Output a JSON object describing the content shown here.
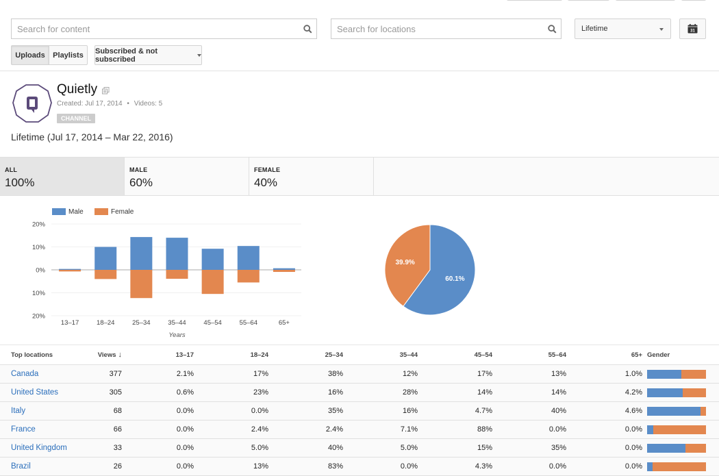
{
  "colors": {
    "male": "#5a8dc8",
    "female": "#e3874f",
    "link": "#2a6ebb",
    "logo": "#5b4a7a"
  },
  "toolbar": {
    "content_search_placeholder": "Search for content",
    "locations_search_placeholder": "Search for locations",
    "period_select": "Lifetime",
    "calendar_day": "31",
    "uploads_label": "Uploads",
    "playlists_label": "Playlists",
    "subscription_filter": "Subscribed & not subscribed"
  },
  "channel": {
    "name": "Quietly",
    "created": "Created: Jul 17, 2014",
    "separator": "•",
    "videos": "Videos: 5",
    "badge": "CHANNEL",
    "logo_letter": "Q"
  },
  "range_label": "Lifetime (Jul 17, 2014 – Mar 22, 2016)",
  "segments": [
    {
      "label": "ALL",
      "value": "100%"
    },
    {
      "label": "MALE",
      "value": "60%"
    },
    {
      "label": "FEMALE",
      "value": "40%"
    }
  ],
  "chart_data": [
    {
      "type": "bar",
      "title": "",
      "xlabel": "Years",
      "ylabel": "",
      "categories": [
        "13–17",
        "18–24",
        "25–34",
        "35–44",
        "45–54",
        "55–64",
        "65+"
      ],
      "series": [
        {
          "name": "Male",
          "values": [
            0.4,
            10.0,
            14.3,
            14.0,
            9.2,
            10.4,
            0.7
          ]
        },
        {
          "name": "Female",
          "values": [
            0.7,
            4.0,
            12.3,
            3.9,
            10.5,
            5.5,
            0.9
          ]
        }
      ],
      "yticks": [
        "20%",
        "10%",
        "0%",
        "10%",
        "20%"
      ],
      "ylim": [
        -20,
        20
      ],
      "grid": true,
      "legend": "top-left",
      "note": "Male bars drawn above zero line, Female bars drawn below (mirrored)"
    },
    {
      "type": "pie",
      "labels": [
        "Male",
        "Female"
      ],
      "values": [
        60.1,
        39.9
      ],
      "data_labels": [
        "60.1%",
        "39.9%"
      ]
    }
  ],
  "table": {
    "headers": [
      "Top locations",
      "Views",
      "13–17",
      "18–24",
      "25–34",
      "35–44",
      "45–54",
      "55–64",
      "65+",
      "Gender"
    ],
    "sort_indicator": "↓",
    "rows": [
      {
        "location": "Canada",
        "views": "377",
        "ages": [
          "2.1%",
          "17%",
          "38%",
          "12%",
          "17%",
          "13%",
          "1.0%"
        ],
        "male_share": 0.58
      },
      {
        "location": "United States",
        "views": "305",
        "ages": [
          "0.6%",
          "23%",
          "16%",
          "28%",
          "14%",
          "14%",
          "4.2%"
        ],
        "male_share": 0.61
      },
      {
        "location": "Italy",
        "views": "68",
        "ages": [
          "0.0%",
          "0.0%",
          "35%",
          "16%",
          "4.7%",
          "40%",
          "4.6%"
        ],
        "male_share": 0.91
      },
      {
        "location": "France",
        "views": "66",
        "ages": [
          "0.0%",
          "2.4%",
          "2.4%",
          "7.1%",
          "88%",
          "0.0%",
          "0.0%"
        ],
        "male_share": 0.11
      },
      {
        "location": "United Kingdom",
        "views": "33",
        "ages": [
          "0.0%",
          "5.0%",
          "40%",
          "5.0%",
          "15%",
          "35%",
          "0.0%"
        ],
        "male_share": 0.65
      },
      {
        "location": "Brazil",
        "views": "26",
        "ages": [
          "0.0%",
          "13%",
          "83%",
          "0.0%",
          "4.3%",
          "0.0%",
          "0.0%"
        ],
        "male_share": 0.09
      }
    ]
  }
}
